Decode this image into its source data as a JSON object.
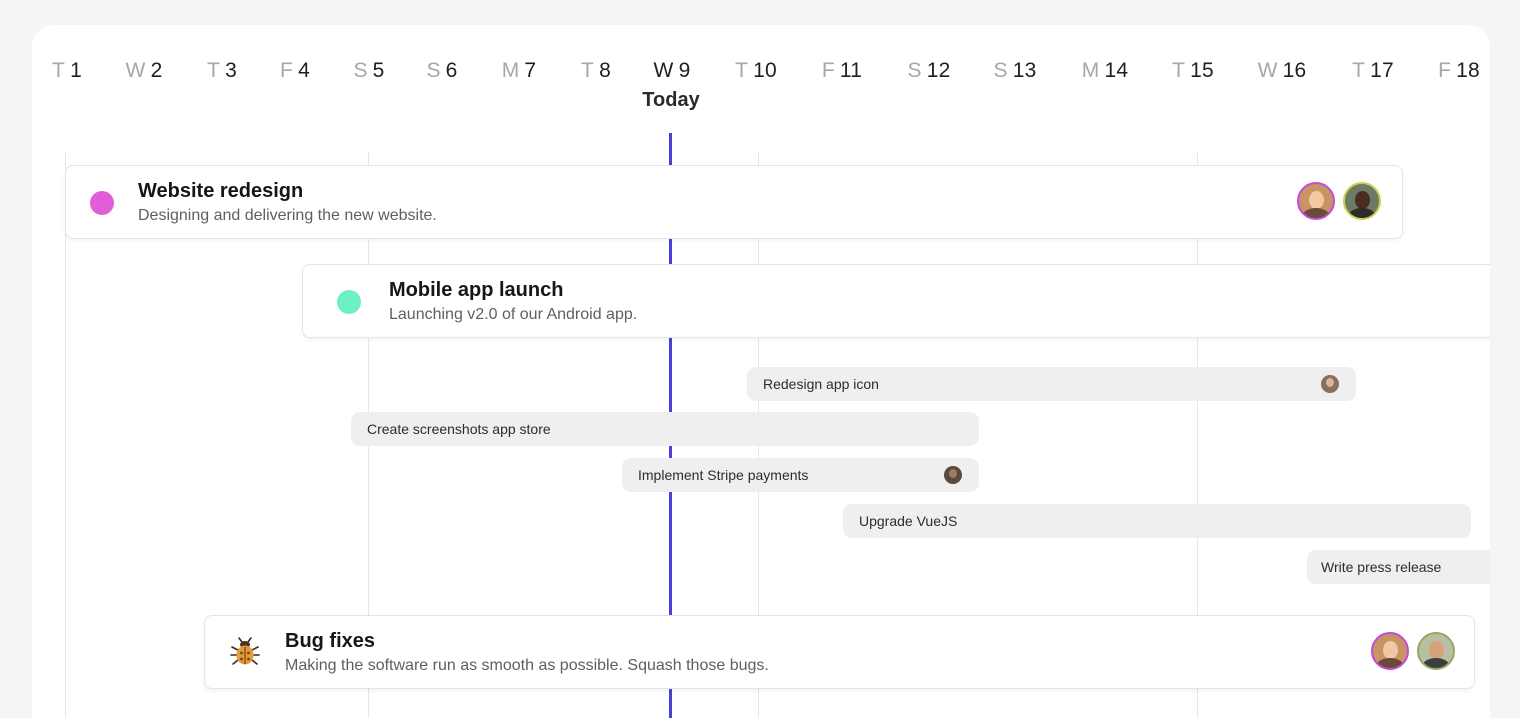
{
  "timeline": {
    "days": [
      {
        "letter": "T",
        "num": "1"
      },
      {
        "letter": "W",
        "num": "2"
      },
      {
        "letter": "T",
        "num": "3"
      },
      {
        "letter": "F",
        "num": "4"
      },
      {
        "letter": "S",
        "num": "5"
      },
      {
        "letter": "S",
        "num": "6"
      },
      {
        "letter": "M",
        "num": "7"
      },
      {
        "letter": "T",
        "num": "8"
      },
      {
        "letter": "W",
        "num": "9"
      },
      {
        "letter": "T",
        "num": "10"
      },
      {
        "letter": "F",
        "num": "11"
      },
      {
        "letter": "S",
        "num": "12"
      },
      {
        "letter": "S",
        "num": "13"
      },
      {
        "letter": "M",
        "num": "14"
      },
      {
        "letter": "T",
        "num": "15"
      },
      {
        "letter": "W",
        "num": "16"
      },
      {
        "letter": "T",
        "num": "17"
      },
      {
        "letter": "F",
        "num": "18"
      }
    ],
    "today_label": "Today",
    "today_color": "#4a3fd6"
  },
  "projects": [
    {
      "title": "Website redesign",
      "description": "Designing and delivering the new website.",
      "dot_color": "#e05ed8",
      "avatars": [
        "avatar-woman",
        "avatar-man"
      ]
    },
    {
      "title": "Mobile app launch",
      "description": "Launching v2.0 of our Android app.",
      "dot_color": "#6df0c4",
      "avatars": []
    },
    {
      "title": "Bug fixes",
      "description": "Making the software run as smooth as possible. Squash those bugs.",
      "icon": "bug-icon",
      "avatars": [
        "avatar-woman",
        "avatar-man"
      ]
    }
  ],
  "tasks": [
    {
      "label": "Redesign app icon",
      "has_avatar": true
    },
    {
      "label": "Create screenshots app store",
      "has_avatar": false
    },
    {
      "label": "Implement Stripe payments",
      "has_avatar": true
    },
    {
      "label": "Upgrade VueJS",
      "has_avatar": false
    },
    {
      "label": "Write press release",
      "has_avatar": false
    }
  ]
}
